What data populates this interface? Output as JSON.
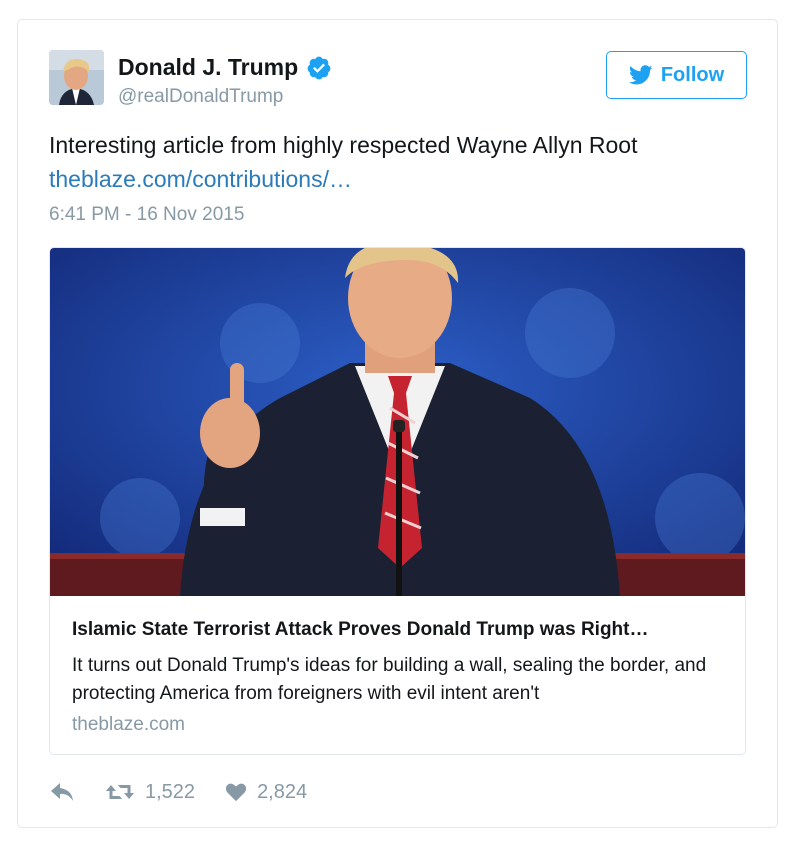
{
  "user": {
    "name": "Donald J. Trump",
    "handle": "@realDonaldTrump"
  },
  "follow_button": {
    "label": "Follow"
  },
  "tweet": {
    "text": "Interesting article from highly respected Wayne Allyn Root",
    "link": "theblaze.com/contributions/…",
    "timestamp": "6:41 PM - 16 Nov 2015"
  },
  "card": {
    "title": "Islamic State Terrorist Attack Proves Donald Trump was Right…",
    "description": "It turns out Donald Trump's ideas for building a wall, sealing the border, and protecting America from foreigners with evil intent aren't",
    "domain": "theblaze.com"
  },
  "actions": {
    "retweets": "1,522",
    "likes": "2,824"
  },
  "colors": {
    "accent": "#1da1f2",
    "link": "#2b7bb9",
    "muted": "#8899a6",
    "stage_blue": "#1c3f9e"
  },
  "icons": [
    "verified-badge-icon",
    "twitter-bird-icon",
    "reply-icon",
    "retweet-icon",
    "heart-icon"
  ]
}
